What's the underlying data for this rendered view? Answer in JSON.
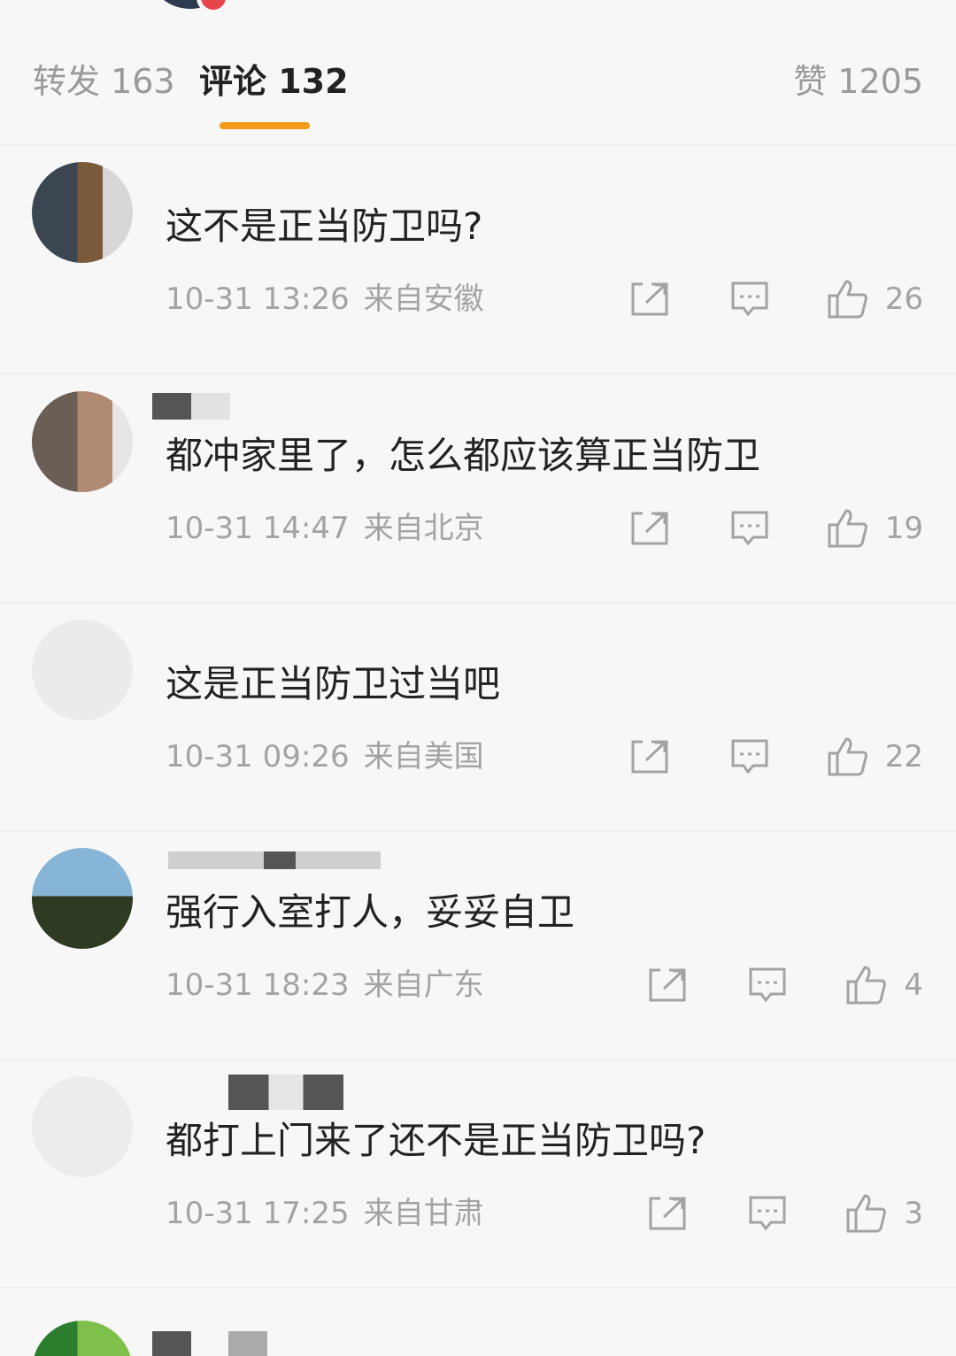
{
  "tabs": {
    "repost": "转发 163",
    "comment": "评论 132",
    "like": "赞 1205",
    "active_color": "#f29b1c"
  },
  "comments": [
    {
      "text": "这不是正当防卫吗?",
      "time": "10-31 13:26",
      "place": "来自安徽",
      "likes": "26"
    },
    {
      "text": "都冲家里了，怎么都应该算正当防卫",
      "time": "10-31 14:47",
      "place": "来自北京",
      "likes": "19"
    },
    {
      "text": "这是正当防卫过当吧",
      "time": "10-31 09:26",
      "place": "来自美国",
      "likes": "22"
    },
    {
      "text": "强行入室打人，妥妥自卫",
      "time": "10-31 18:23",
      "place": "来自广东",
      "likes": "4"
    },
    {
      "text": "都打上门来了还不是正当防卫吗?",
      "time": "10-31 17:25",
      "place": "来自甘肃",
      "likes": "3"
    }
  ],
  "icons": {
    "repost": "share-icon",
    "reply": "comment-icon",
    "like": "thumb-up-icon"
  }
}
